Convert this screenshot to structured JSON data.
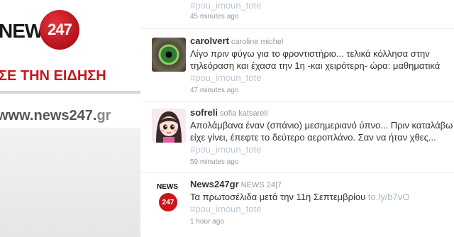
{
  "brand": {
    "news_text": "NEWS",
    "number_text": "247",
    "tagline": "ΣΕ ΤΗΝ ΕΙΔΗΣΗ",
    "url_main": "www.news247.",
    "url_tld": "gr"
  },
  "tweets": [
    {
      "hashtag": "#pou_imoun_tote",
      "timestamp": "45 minutes ago"
    },
    {
      "screen_name": "carolvert",
      "full_name": "caroline michel",
      "text_line1": "Λίγο πριν φύγω για το φροντιστήριο... τελικά κόλλησα στην",
      "text_line2": "τηλεόραση και έχασα την 1η -και χειρότερη- ώρα: μαθηματικά",
      "hashtag": "#pou_imoun_tote",
      "timestamp": "47 minutes ago",
      "avatar_icon": "green-eye-avatar"
    },
    {
      "screen_name": "sofreli",
      "full_name": "sofia katsareli",
      "text_line1": "Απολάμβανα έναν (σπάνιο) μεσημεριανό ύπνο... Πριν καταλάβω",
      "text_line2": "είχε γίνει, έπεφτε το δεύτερο αεροπλάνο. Σαν να ήταν χθες...",
      "hashtag": "#pou_imoun_tote",
      "timestamp": "59 minutes ago",
      "avatar_icon": "cartoon-girl-avatar"
    },
    {
      "screen_name": "News247gr",
      "full_name": "NEWS 24|7",
      "text_line1": "Τα πρωτοσέλιδα μετά την 11η Σεπτεμβρίου",
      "link": "to.ly/b7vO",
      "hashtag": "#pou_imoun_tote",
      "timestamp": "1 hour ago",
      "avatar_news": "NEWS",
      "avatar_num": "247"
    }
  ],
  "colors": {
    "brand_red": "#c8161d",
    "hashtag": "#b9c8d6",
    "timestamp": "#999999"
  }
}
